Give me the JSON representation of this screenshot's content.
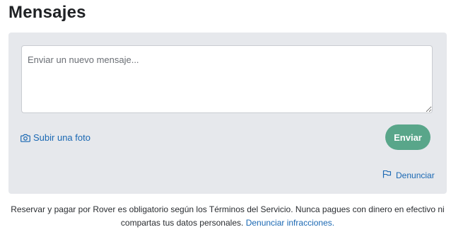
{
  "header": {
    "title": "Mensajes"
  },
  "composer": {
    "placeholder": "Enviar un nuevo mensaje...",
    "upload_label": "Subir una foto",
    "upload_icon": "camera-icon",
    "send_label": "Enviar",
    "report_label": "Denunciar",
    "report_icon": "flag-icon"
  },
  "footer": {
    "line1": "Reservar y pagar por Rover es obligatorio según los Términos del Servicio. Nunca pagues con dinero en efectivo ni compartas tus datos personales.",
    "link_label": "Denunciar infracciones."
  },
  "colors": {
    "accent_green": "#59a68a",
    "link_blue": "#1a68b3",
    "panel_bg": "#e6e8ec"
  }
}
